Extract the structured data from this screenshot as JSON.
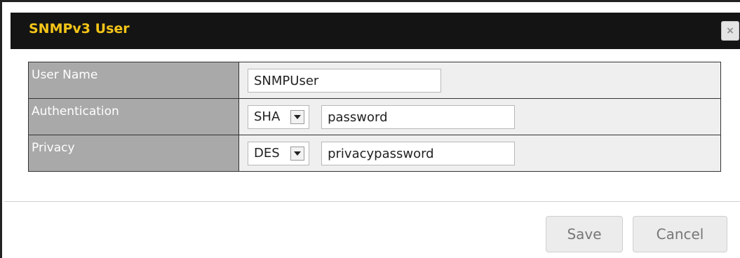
{
  "dialog": {
    "title": "SNMPv3 User",
    "close_glyph": "×"
  },
  "form": {
    "user_name": {
      "label": "User Name",
      "value": "SNMPUser"
    },
    "authentication": {
      "label": "Authentication",
      "method": "SHA",
      "password": "password"
    },
    "privacy": {
      "label": "Privacy",
      "method": "DES",
      "password": "privacypassword"
    }
  },
  "buttons": {
    "save": "Save",
    "cancel": "Cancel"
  },
  "colors": {
    "title_text": "#f5c518",
    "title_bar": "#141414",
    "label_cell": "#a9a9a9",
    "field_cell": "#efefef"
  },
  "icons": {
    "close": "close-icon",
    "dropdown": "chevron-down-icon"
  }
}
